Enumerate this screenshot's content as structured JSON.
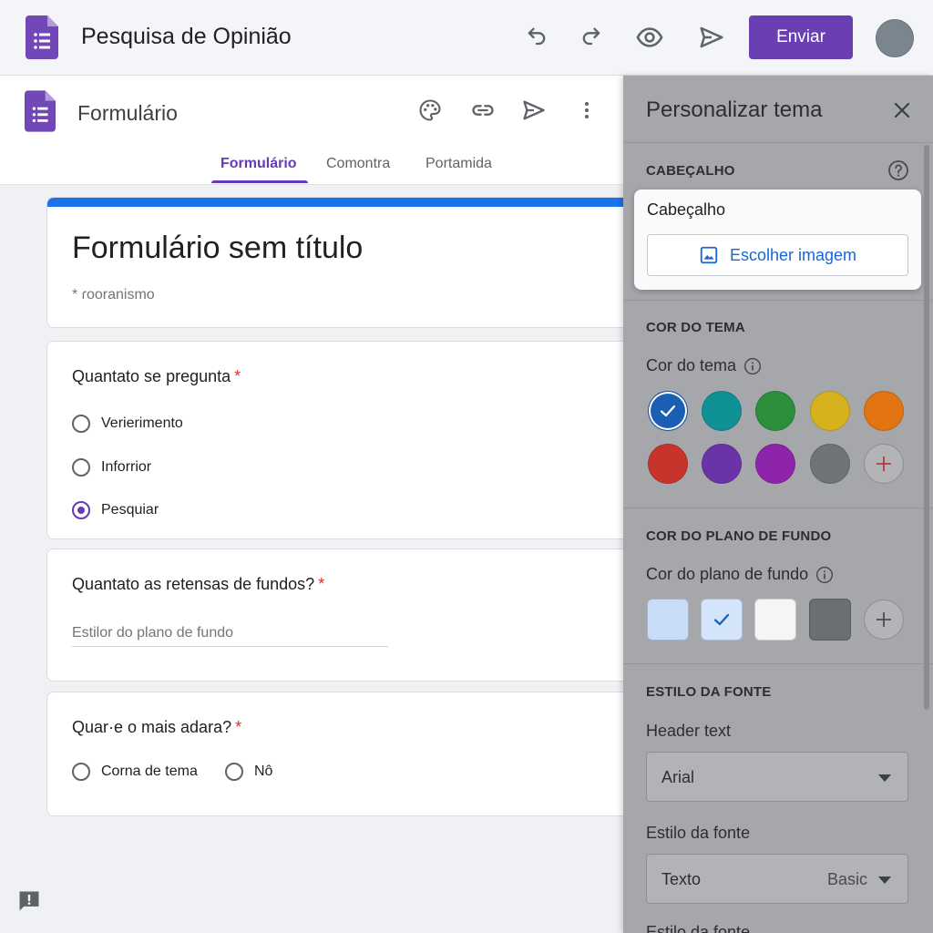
{
  "app": {
    "doc_title": "Pesquisa de Opinião",
    "send_label": "Enviar",
    "accent_color": "#673ab7"
  },
  "form_header": {
    "title": "Formulário",
    "tabs": [
      {
        "label": "Formulário",
        "active": true
      },
      {
        "label": "Comontra",
        "active": false
      },
      {
        "label": "Portamida",
        "active": false
      }
    ]
  },
  "form": {
    "title": "Formulário sem título",
    "description": "* ɾooranismo",
    "questions": [
      {
        "title": "Quantato se pregunta",
        "required_mark": "*",
        "options": [
          "Verierimento",
          "Inforrior",
          "Pesquiar"
        ],
        "selected_index": 2
      },
      {
        "title": "Quantato as retensas de fundos?",
        "required_mark": "*",
        "placeholder": "Estilor do plano de fundo"
      },
      {
        "title": "Quar·e o mais adara?",
        "required_mark": "*",
        "options": [
          "Corna de tema",
          "Nô"
        ]
      }
    ]
  },
  "theme_panel": {
    "title": "Personalizar tema",
    "header_section": {
      "label": "CABEÇALHO",
      "popup_label": "Cabeçalho",
      "choose_image": "Escolher imagem"
    },
    "theme_color": {
      "section": "COR DO TEMA",
      "label": "Cor do tema",
      "colors": [
        "#1a5fb4",
        "#0f9196",
        "#2c8f3c",
        "#d6b21e",
        "#e27512",
        "#c8342c",
        "#6a33a8",
        "#8e24aa",
        "#6f7479"
      ],
      "selected_index": 0
    },
    "background_color": {
      "section": "COR DO PLANO DE FUNDO",
      "label": "Cor do plano de fundo",
      "colors": [
        "#c9dcf8",
        "#d4e4fb",
        "#f5f5f5",
        "#6a6f74"
      ],
      "selected_index": 1
    },
    "font_style": {
      "section": "ESTILO DA FONTE",
      "header_label": "Header text",
      "header_value": "Arial",
      "style_label": "Estilo da fonte",
      "style_value": "Texto",
      "style_extra": "Basic",
      "cut_label": "Estilo da fonte"
    }
  }
}
